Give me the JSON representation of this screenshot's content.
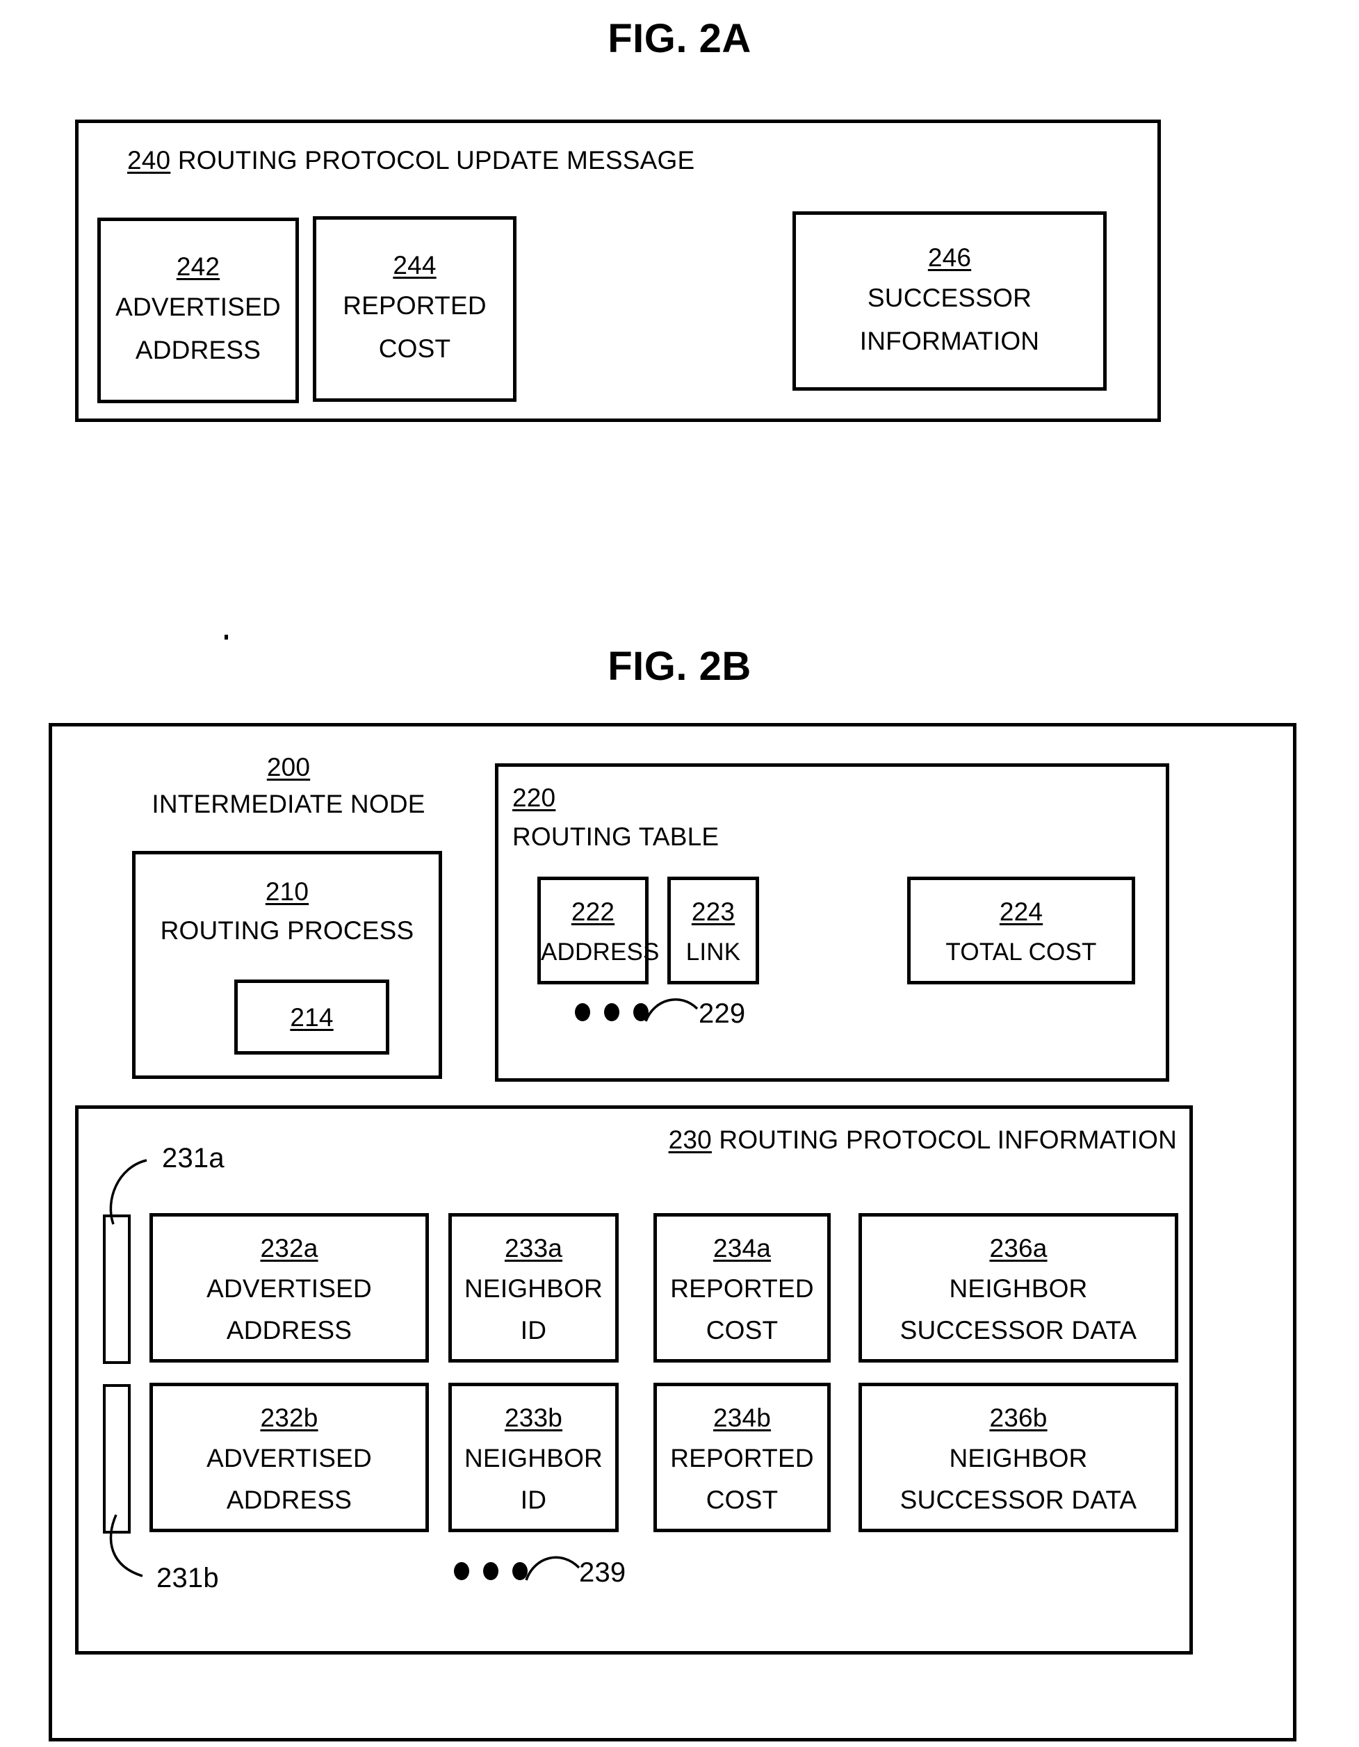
{
  "figures": [
    {
      "title": "FIG. 2A",
      "container": {
        "ref": "240",
        "label": "ROUTING PROTOCOL UPDATE MESSAGE"
      },
      "fields": [
        {
          "ref": "242",
          "line1": "ADVERTISED",
          "line2": "ADDRESS"
        },
        {
          "ref": "244",
          "line1": "REPORTED",
          "line2": "COST"
        },
        {
          "ref": "246",
          "line1": "SUCCESSOR",
          "line2": "INFORMATION"
        }
      ]
    },
    {
      "title": "FIG. 2B",
      "node": {
        "ref": "200",
        "label": "INTERMEDIATE NODE"
      },
      "routing_process": {
        "ref": "210",
        "label": "ROUTING PROCESS"
      },
      "routing_process_inner": {
        "ref": "214"
      },
      "routing_table": {
        "ref": "220",
        "label": "ROUTING TABLE",
        "columns": [
          {
            "ref": "222",
            "label": "ADDRESS"
          },
          {
            "ref": "223",
            "label": "LINK"
          },
          {
            "ref": "224",
            "label": "TOTAL COST"
          }
        ],
        "continuation_ref": "229"
      },
      "routing_protocol_information": {
        "ref": "230",
        "label": "ROUTING PROTOCOL INFORMATION",
        "entry_refs": [
          "231a",
          "231b"
        ],
        "continuation_ref": "239",
        "rows": [
          {
            "entry_ref": "231a",
            "cells": [
              {
                "ref": "232a",
                "line1": "ADVERTISED",
                "line2": "ADDRESS"
              },
              {
                "ref": "233a",
                "line1": "NEIGHBOR",
                "line2": "ID"
              },
              {
                "ref": "234a",
                "line1": "REPORTED",
                "line2": "COST"
              },
              {
                "ref": "236a",
                "line1": "NEIGHBOR",
                "line2": "SUCCESSOR DATA"
              }
            ]
          },
          {
            "entry_ref": "231b",
            "cells": [
              {
                "ref": "232b",
                "line1": "ADVERTISED",
                "line2": "ADDRESS"
              },
              {
                "ref": "233b",
                "line1": "NEIGHBOR",
                "line2": "ID"
              },
              {
                "ref": "234b",
                "line1": "REPORTED",
                "line2": "COST"
              },
              {
                "ref": "236b",
                "line1": "NEIGHBOR",
                "line2": "SUCCESSOR DATA"
              }
            ]
          }
        ]
      }
    }
  ]
}
